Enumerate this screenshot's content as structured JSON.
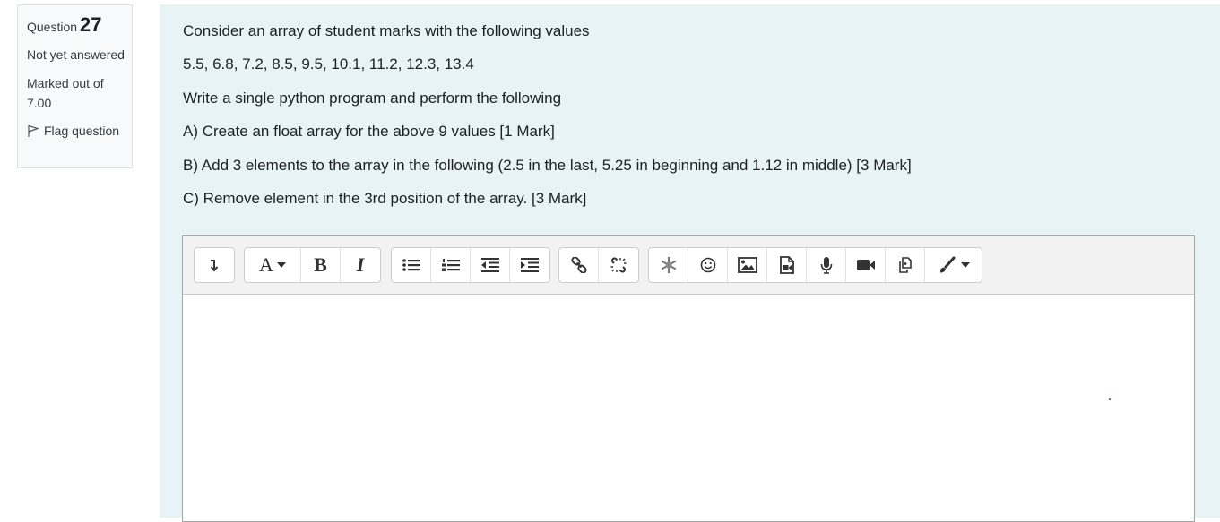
{
  "question_info": {
    "label": "Question",
    "number": "27",
    "state": "Not yet answered",
    "grade": "Marked out of 7.00",
    "flag_label": "Flag question"
  },
  "question_text": [
    "Consider an array of student marks with the following values",
    "5.5, 6.8, 7.2, 8.5, 9.5, 10.1, 11.2, 12.3, 13.4",
    "Write a single python program and perform the following",
    "A) Create an float array for the above 9 values  [1 Mark]",
    "B) Add 3 elements to the array in the following (2.5 in the last, 5.25 in beginning and 1.12 in middle) [3 Mark]",
    "C) Remove element in the 3rd position of the array. [3 Mark]"
  ],
  "toolbar": {
    "font_button_label": "A",
    "bold_label": "B",
    "italic_label": "I",
    "groups": [
      [
        "collapse-icon"
      ],
      [
        "font-style-icon",
        "bold-icon",
        "italic-icon"
      ],
      [
        "unordered-list-icon",
        "ordered-list-icon",
        "outdent-icon",
        "indent-icon"
      ],
      [
        "link-icon",
        "unlink-icon"
      ],
      [
        "snowflake-icon",
        "emoji-icon",
        "image-icon",
        "media-icon",
        "record-audio-icon",
        "record-video-icon",
        "manage-files-icon",
        "paint-brush-icon"
      ]
    ]
  },
  "editor": {
    "value": ""
  },
  "colors": {
    "content_bg": "#e7f3f5",
    "info_bg": "#f8f9fa",
    "toolbar_bg": "#f2f2f2"
  }
}
